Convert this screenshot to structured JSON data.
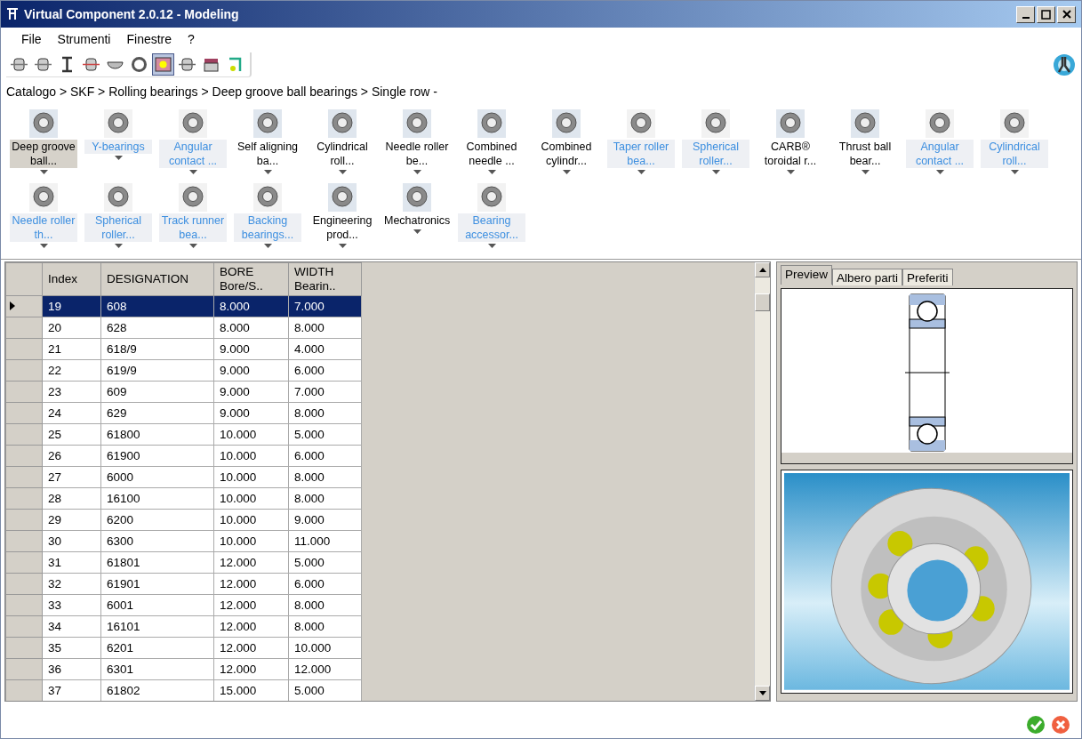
{
  "window": {
    "title": "Virtual Component 2.0.12 - Modeling"
  },
  "menu": [
    "File",
    "Strumenti",
    "Finestre",
    "?"
  ],
  "toolbar": [
    {
      "selected": false
    },
    {
      "selected": false
    },
    {
      "selected": false
    },
    {
      "selected": false
    },
    {
      "selected": false
    },
    {
      "selected": false
    },
    {
      "selected": true
    },
    {
      "selected": false
    },
    {
      "selected": false
    },
    {
      "selected": false
    }
  ],
  "breadcrumb": "Catalogo > SKF > Rolling bearings > Deep groove ball bearings > Single row -",
  "categories": [
    {
      "label": "Deep groove ball...",
      "selected": true,
      "highlighted": false
    },
    {
      "label": "Y-bearings",
      "selected": false,
      "highlighted": true
    },
    {
      "label": "Angular contact ...",
      "selected": false,
      "highlighted": true
    },
    {
      "label": "Self aligning ba...",
      "selected": false,
      "highlighted": false
    },
    {
      "label": "Cylindrical roll...",
      "selected": false,
      "highlighted": false
    },
    {
      "label": "Needle roller be...",
      "selected": false,
      "highlighted": false
    },
    {
      "label": "Combined needle ...",
      "selected": false,
      "highlighted": false
    },
    {
      "label": "Combined cylindr...",
      "selected": false,
      "highlighted": false
    },
    {
      "label": "Taper roller bea...",
      "selected": false,
      "highlighted": true
    },
    {
      "label": "Spherical roller...",
      "selected": false,
      "highlighted": true
    },
    {
      "label": "CARB® toroidal r...",
      "selected": false,
      "highlighted": false
    },
    {
      "label": "Thrust ball bear...",
      "selected": false,
      "highlighted": false
    },
    {
      "label": "Angular contact ...",
      "selected": false,
      "highlighted": true
    },
    {
      "label": "Cylindrical roll...",
      "selected": false,
      "highlighted": true
    },
    {
      "label": "Needle roller th...",
      "selected": false,
      "highlighted": true
    },
    {
      "label": "Spherical roller...",
      "selected": false,
      "highlighted": true
    },
    {
      "label": "Track runner bea...",
      "selected": false,
      "highlighted": true
    },
    {
      "label": "Backing bearings...",
      "selected": false,
      "highlighted": true
    },
    {
      "label": "Engineering prod...",
      "selected": false,
      "highlighted": false
    },
    {
      "label": "Mechatronics",
      "selected": false,
      "highlighted": false
    },
    {
      "label": "Bearing accessor...",
      "selected": false,
      "highlighted": true
    }
  ],
  "table": {
    "columns": [
      {
        "title": "Index"
      },
      {
        "title": "DESIGNATION"
      },
      {
        "title": "BORE",
        "subtitle": "Bore/S.."
      },
      {
        "title": "WIDTH",
        "subtitle": "Bearin.."
      }
    ],
    "rows": [
      {
        "selected": true,
        "cells": [
          "19",
          "608",
          "8.000",
          "7.000"
        ]
      },
      {
        "selected": false,
        "cells": [
          "20",
          "628",
          "8.000",
          "8.000"
        ]
      },
      {
        "selected": false,
        "cells": [
          "21",
          "618/9",
          "9.000",
          "4.000"
        ]
      },
      {
        "selected": false,
        "cells": [
          "22",
          "619/9",
          "9.000",
          "6.000"
        ]
      },
      {
        "selected": false,
        "cells": [
          "23",
          "609",
          "9.000",
          "7.000"
        ]
      },
      {
        "selected": false,
        "cells": [
          "24",
          "629",
          "9.000",
          "8.000"
        ]
      },
      {
        "selected": false,
        "cells": [
          "25",
          "61800",
          "10.000",
          "5.000"
        ]
      },
      {
        "selected": false,
        "cells": [
          "26",
          "61900",
          "10.000",
          "6.000"
        ]
      },
      {
        "selected": false,
        "cells": [
          "27",
          "6000",
          "10.000",
          "8.000"
        ]
      },
      {
        "selected": false,
        "cells": [
          "28",
          "16100",
          "10.000",
          "8.000"
        ]
      },
      {
        "selected": false,
        "cells": [
          "29",
          "6200",
          "10.000",
          "9.000"
        ]
      },
      {
        "selected": false,
        "cells": [
          "30",
          "6300",
          "10.000",
          "11.000"
        ]
      },
      {
        "selected": false,
        "cells": [
          "31",
          "61801",
          "12.000",
          "5.000"
        ]
      },
      {
        "selected": false,
        "cells": [
          "32",
          "61901",
          "12.000",
          "6.000"
        ]
      },
      {
        "selected": false,
        "cells": [
          "33",
          "6001",
          "12.000",
          "8.000"
        ]
      },
      {
        "selected": false,
        "cells": [
          "34",
          "16101",
          "12.000",
          "8.000"
        ]
      },
      {
        "selected": false,
        "cells": [
          "35",
          "6201",
          "12.000",
          "10.000"
        ]
      },
      {
        "selected": false,
        "cells": [
          "36",
          "6301",
          "12.000",
          "12.000"
        ]
      },
      {
        "selected": false,
        "cells": [
          "37",
          "61802",
          "15.000",
          "5.000"
        ]
      }
    ]
  },
  "side_tabs": [
    {
      "label": "Preview",
      "selected": true
    },
    {
      "label": "Albero parti",
      "selected": false
    },
    {
      "label": "Preferiti",
      "selected": false
    }
  ]
}
